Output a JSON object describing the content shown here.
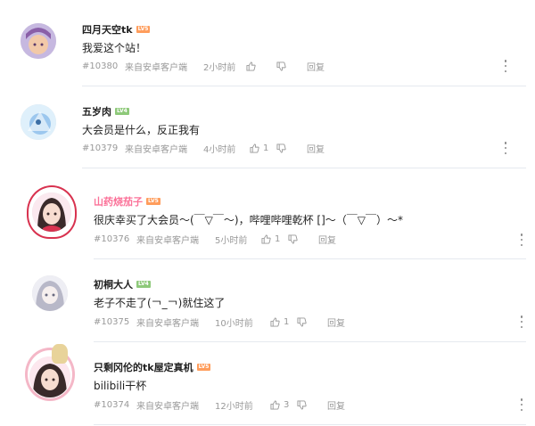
{
  "comments": [
    {
      "username": "四月天空tk",
      "level": "LV5",
      "level_color": "#ff9d5c",
      "name_color": "#222222",
      "text": "我爱这个站！",
      "floor": "#10380",
      "source": "来自安卓客户端",
      "time": "2小时前",
      "likes": "",
      "reply": "回复",
      "avatar_colors": [
        "#c6b8e0",
        "#f2c9a8"
      ]
    },
    {
      "username": "五岁肉",
      "level": "LV4",
      "level_color": "#8ec97a",
      "name_color": "#222222",
      "text": "大会员是什么，反正我有",
      "floor": "#10379",
      "source": "来自安卓客户端",
      "time": "4小时前",
      "likes": "1",
      "reply": "回复",
      "avatar_colors": [
        "#9cc7ee",
        "#dff0fb"
      ]
    },
    {
      "username": "山药烧茄子",
      "level": "LV5",
      "level_color": "#ff9d5c",
      "name_color": "#fb7299",
      "text": "很庆幸买了大会员～(￣▽￣～)，哔哩哔哩乾杯 []～（￣▽￣）～*",
      "floor": "#10376",
      "source": "来自安卓客户端",
      "time": "5小时前",
      "likes": "1",
      "reply": "回复",
      "avatar_colors": [
        "#3a2a2a",
        "#f7dcd0"
      ]
    },
    {
      "username": "初桐大人",
      "level": "LV4",
      "level_color": "#8ec97a",
      "name_color": "#222222",
      "text": "老子不走了(￢_￢)就住这了",
      "floor": "#10375",
      "source": "来自安卓客户端",
      "time": "10小时前",
      "likes": "1",
      "reply": "回复",
      "avatar_colors": [
        "#b8b8c8",
        "#eeeef4"
      ]
    },
    {
      "username": "只剩冈伦的tk屋定真机",
      "level": "LV5",
      "level_color": "#ff9d5c",
      "name_color": "#222222",
      "text": "bilibili干杯",
      "floor": "#10374",
      "source": "来自安卓客户端",
      "time": "12小时前",
      "likes": "3",
      "reply": "回复",
      "avatar_colors": [
        "#e8d39a",
        "#f4b7c7"
      ]
    }
  ]
}
